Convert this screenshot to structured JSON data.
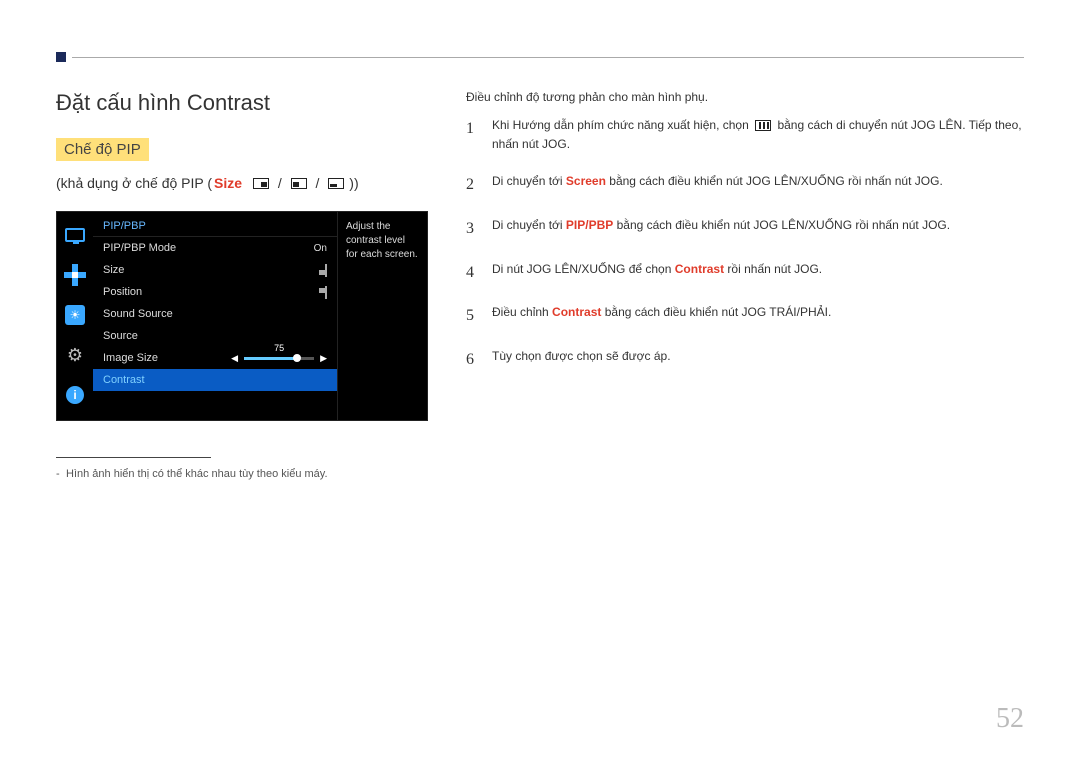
{
  "page_number": "52",
  "title": "Đặt cấu hình Contrast",
  "mode_badge": "Chế độ PIP",
  "subline": {
    "prefix": "(khả dụng ở chế độ PIP (",
    "size_label": "Size",
    "suffix": "))"
  },
  "osd": {
    "title": "PIP/PBP",
    "rows": {
      "mode": {
        "label": "PIP/PBP Mode",
        "value": "On"
      },
      "size": {
        "label": "Size"
      },
      "position": {
        "label": "Position"
      },
      "sound": {
        "label": "Sound Source"
      },
      "source": {
        "label": "Source"
      },
      "imgsize": {
        "label": "Image Size"
      },
      "contrast": {
        "label": "Contrast",
        "value": "75"
      }
    },
    "help_text": "Adjust the contrast level for each screen."
  },
  "footnote": "Hình ảnh hiển thị có thể khác nhau tùy theo kiểu máy.",
  "intro": "Điều chỉnh độ tương phản cho màn hình phụ.",
  "steps": {
    "s1": {
      "num": "1",
      "t1": "Khi Hướng dẫn phím chức năng xuất hiện, chọn ",
      "t2": " bằng cách di chuyển nút JOG LÊN. Tiếp theo, nhấn nút JOG."
    },
    "s2": {
      "num": "2",
      "t1": "Di chuyển tới ",
      "hl": "Screen",
      "t2": " bằng cách điều khiển nút JOG LÊN/XUỐNG rồi nhấn nút JOG."
    },
    "s3": {
      "num": "3",
      "t1": "Di chuyển tới ",
      "hl": "PIP/PBP",
      "t2": " bằng cách điều khiển nút JOG LÊN/XUỐNG rồi nhấn nút JOG."
    },
    "s4": {
      "num": "4",
      "t1": "Di nút JOG LÊN/XUỐNG để chọn ",
      "hl": "Contrast",
      "t2": " rồi nhấn nút JOG."
    },
    "s5": {
      "num": "5",
      "t1": "Điều chỉnh ",
      "hl": "Contrast",
      "t2": " bằng cách điều khiển nút JOG TRÁI/PHẢI."
    },
    "s6": {
      "num": "6",
      "t1": "Tùy chọn được chọn sẽ được áp."
    }
  }
}
